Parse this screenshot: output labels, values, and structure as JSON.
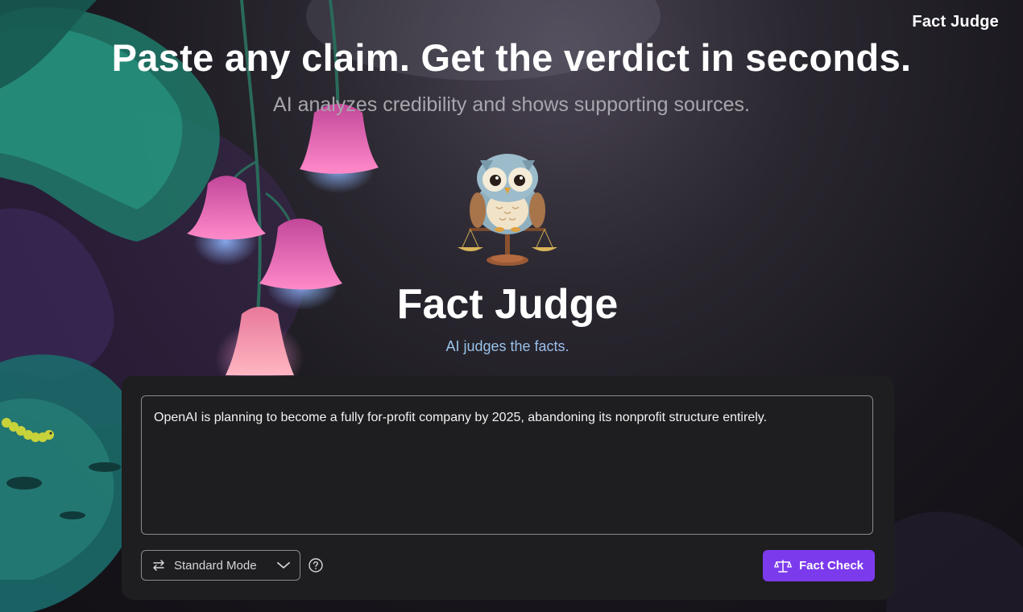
{
  "header": {
    "brand": "Fact Judge"
  },
  "hero": {
    "headline": "Paste any claim. Get the verdict in seconds.",
    "subheadline": "AI analyzes credibility and shows supporting sources."
  },
  "app": {
    "title": "Fact Judge",
    "tagline": "AI judges the facts.",
    "mascot_icon": "owl-with-scales-icon"
  },
  "form": {
    "claim_text": "OpenAI is planning to become a fully for-profit company by 2025, abandoning its nonprofit structure entirely.",
    "mode": {
      "selected": "Standard Mode",
      "icon": "swap-arrows-icon",
      "dropdown_icon": "chevron-down-icon"
    },
    "help_icon": "question-circle-icon",
    "submit": {
      "label": "Fact Check",
      "icon": "scales-icon"
    }
  },
  "colors": {
    "accent": "#7c3aed",
    "panel": "#1e1e20",
    "background": "#17151b"
  }
}
